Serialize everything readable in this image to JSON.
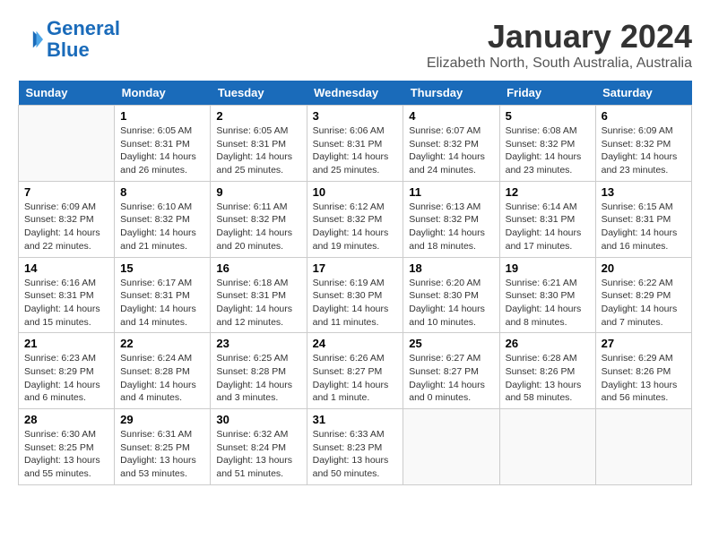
{
  "logo": {
    "line1": "General",
    "line2": "Blue"
  },
  "title": "January 2024",
  "subtitle": "Elizabeth North, South Australia, Australia",
  "days_of_week": [
    "Sunday",
    "Monday",
    "Tuesday",
    "Wednesday",
    "Thursday",
    "Friday",
    "Saturday"
  ],
  "weeks": [
    [
      {
        "day": "",
        "details": ""
      },
      {
        "day": "1",
        "details": "Sunrise: 6:05 AM\nSunset: 8:31 PM\nDaylight: 14 hours\nand 26 minutes."
      },
      {
        "day": "2",
        "details": "Sunrise: 6:05 AM\nSunset: 8:31 PM\nDaylight: 14 hours\nand 25 minutes."
      },
      {
        "day": "3",
        "details": "Sunrise: 6:06 AM\nSunset: 8:31 PM\nDaylight: 14 hours\nand 25 minutes."
      },
      {
        "day": "4",
        "details": "Sunrise: 6:07 AM\nSunset: 8:32 PM\nDaylight: 14 hours\nand 24 minutes."
      },
      {
        "day": "5",
        "details": "Sunrise: 6:08 AM\nSunset: 8:32 PM\nDaylight: 14 hours\nand 23 minutes."
      },
      {
        "day": "6",
        "details": "Sunrise: 6:09 AM\nSunset: 8:32 PM\nDaylight: 14 hours\nand 23 minutes."
      }
    ],
    [
      {
        "day": "7",
        "details": "Sunrise: 6:09 AM\nSunset: 8:32 PM\nDaylight: 14 hours\nand 22 minutes."
      },
      {
        "day": "8",
        "details": "Sunrise: 6:10 AM\nSunset: 8:32 PM\nDaylight: 14 hours\nand 21 minutes."
      },
      {
        "day": "9",
        "details": "Sunrise: 6:11 AM\nSunset: 8:32 PM\nDaylight: 14 hours\nand 20 minutes."
      },
      {
        "day": "10",
        "details": "Sunrise: 6:12 AM\nSunset: 8:32 PM\nDaylight: 14 hours\nand 19 minutes."
      },
      {
        "day": "11",
        "details": "Sunrise: 6:13 AM\nSunset: 8:32 PM\nDaylight: 14 hours\nand 18 minutes."
      },
      {
        "day": "12",
        "details": "Sunrise: 6:14 AM\nSunset: 8:31 PM\nDaylight: 14 hours\nand 17 minutes."
      },
      {
        "day": "13",
        "details": "Sunrise: 6:15 AM\nSunset: 8:31 PM\nDaylight: 14 hours\nand 16 minutes."
      }
    ],
    [
      {
        "day": "14",
        "details": "Sunrise: 6:16 AM\nSunset: 8:31 PM\nDaylight: 14 hours\nand 15 minutes."
      },
      {
        "day": "15",
        "details": "Sunrise: 6:17 AM\nSunset: 8:31 PM\nDaylight: 14 hours\nand 14 minutes."
      },
      {
        "day": "16",
        "details": "Sunrise: 6:18 AM\nSunset: 8:31 PM\nDaylight: 14 hours\nand 12 minutes."
      },
      {
        "day": "17",
        "details": "Sunrise: 6:19 AM\nSunset: 8:30 PM\nDaylight: 14 hours\nand 11 minutes."
      },
      {
        "day": "18",
        "details": "Sunrise: 6:20 AM\nSunset: 8:30 PM\nDaylight: 14 hours\nand 10 minutes."
      },
      {
        "day": "19",
        "details": "Sunrise: 6:21 AM\nSunset: 8:30 PM\nDaylight: 14 hours\nand 8 minutes."
      },
      {
        "day": "20",
        "details": "Sunrise: 6:22 AM\nSunset: 8:29 PM\nDaylight: 14 hours\nand 7 minutes."
      }
    ],
    [
      {
        "day": "21",
        "details": "Sunrise: 6:23 AM\nSunset: 8:29 PM\nDaylight: 14 hours\nand 6 minutes."
      },
      {
        "day": "22",
        "details": "Sunrise: 6:24 AM\nSunset: 8:28 PM\nDaylight: 14 hours\nand 4 minutes."
      },
      {
        "day": "23",
        "details": "Sunrise: 6:25 AM\nSunset: 8:28 PM\nDaylight: 14 hours\nand 3 minutes."
      },
      {
        "day": "24",
        "details": "Sunrise: 6:26 AM\nSunset: 8:27 PM\nDaylight: 14 hours\nand 1 minute."
      },
      {
        "day": "25",
        "details": "Sunrise: 6:27 AM\nSunset: 8:27 PM\nDaylight: 14 hours\nand 0 minutes."
      },
      {
        "day": "26",
        "details": "Sunrise: 6:28 AM\nSunset: 8:26 PM\nDaylight: 13 hours\nand 58 minutes."
      },
      {
        "day": "27",
        "details": "Sunrise: 6:29 AM\nSunset: 8:26 PM\nDaylight: 13 hours\nand 56 minutes."
      }
    ],
    [
      {
        "day": "28",
        "details": "Sunrise: 6:30 AM\nSunset: 8:25 PM\nDaylight: 13 hours\nand 55 minutes."
      },
      {
        "day": "29",
        "details": "Sunrise: 6:31 AM\nSunset: 8:25 PM\nDaylight: 13 hours\nand 53 minutes."
      },
      {
        "day": "30",
        "details": "Sunrise: 6:32 AM\nSunset: 8:24 PM\nDaylight: 13 hours\nand 51 minutes."
      },
      {
        "day": "31",
        "details": "Sunrise: 6:33 AM\nSunset: 8:23 PM\nDaylight: 13 hours\nand 50 minutes."
      },
      {
        "day": "",
        "details": ""
      },
      {
        "day": "",
        "details": ""
      },
      {
        "day": "",
        "details": ""
      }
    ]
  ]
}
